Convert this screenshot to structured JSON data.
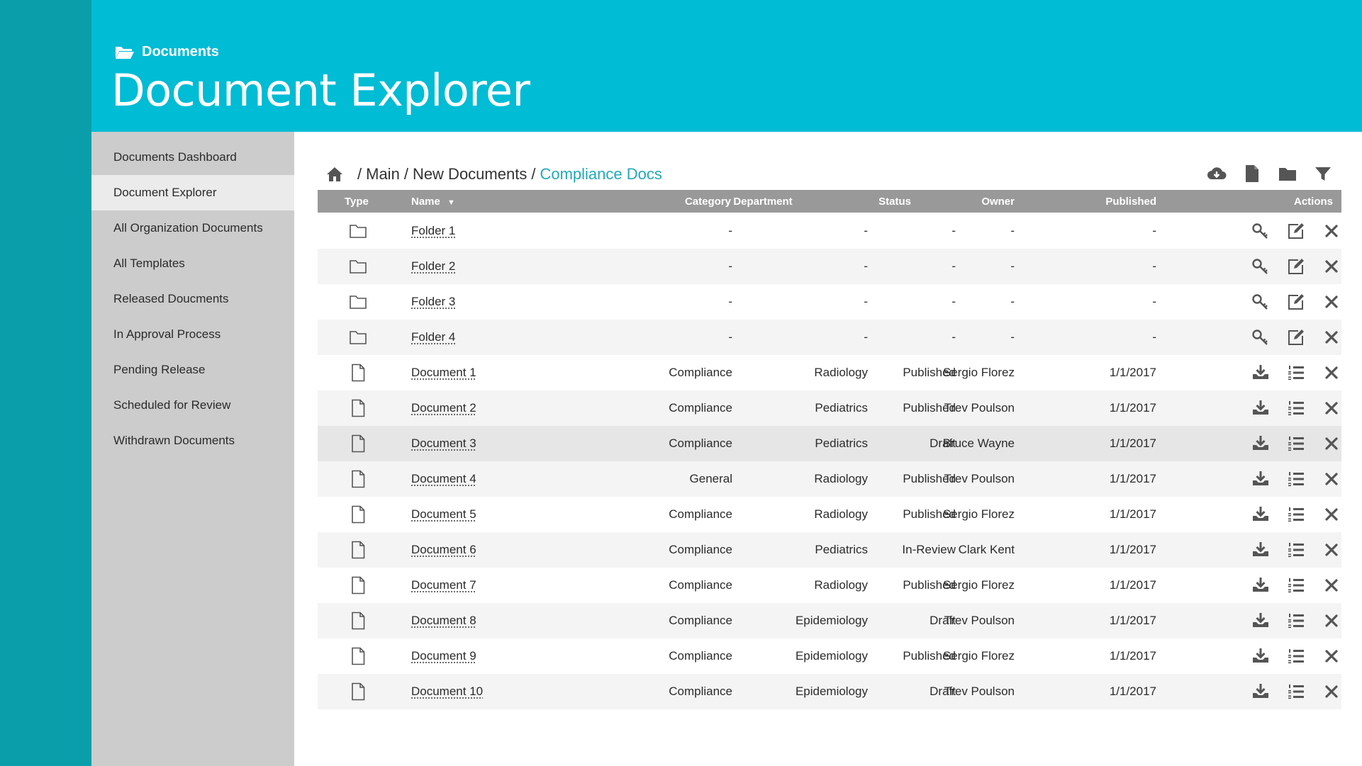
{
  "header": {
    "section": "Documents",
    "title": "Document Explorer"
  },
  "sidebar": {
    "items": [
      {
        "label": "Documents Dashboard"
      },
      {
        "label": "Document Explorer",
        "active": true
      },
      {
        "label": "All Organization Documents"
      },
      {
        "label": "All Templates"
      },
      {
        "label": "Released Doucments"
      },
      {
        "label": "In Approval Process"
      },
      {
        "label": "Pending Release"
      },
      {
        "label": "Scheduled for Review"
      },
      {
        "label": "Withdrawn Documents"
      }
    ]
  },
  "breadcrumb": {
    "home_icon": "home-icon",
    "sep": "/",
    "items": [
      "Main",
      "New Documents"
    ],
    "current": "Compliance Docs"
  },
  "toolbar_icons": [
    "cloud-download-icon",
    "new-document-icon",
    "new-folder-icon",
    "filter-icon"
  ],
  "table": {
    "columns": {
      "type": "Type",
      "name": "Name",
      "category": "Category",
      "department": "Department",
      "status": "Status",
      "owner": "Owner",
      "published": "Published",
      "actions": "Actions"
    },
    "rows": [
      {
        "type": "folder",
        "name": "Folder 1",
        "category": "-",
        "department": "-",
        "status": "-",
        "owner": "-",
        "published": "-"
      },
      {
        "type": "folder",
        "name": "Folder 2",
        "category": "-",
        "department": "-",
        "status": "-",
        "owner": "-",
        "published": "-"
      },
      {
        "type": "folder",
        "name": "Folder 3",
        "category": "-",
        "department": "-",
        "status": "-",
        "owner": "-",
        "published": "-"
      },
      {
        "type": "folder",
        "name": "Folder 4",
        "category": "-",
        "department": "-",
        "status": "-",
        "owner": "-",
        "published": "-"
      },
      {
        "type": "document",
        "name": "Document 1",
        "category": "Compliance",
        "department": "Radiology",
        "status": "Published",
        "owner": "Sergio Florez",
        "published": "1/1/2017"
      },
      {
        "type": "document",
        "name": "Document 2",
        "category": "Compliance",
        "department": "Pediatrics",
        "status": "Published",
        "owner": "Trev Poulson",
        "published": "1/1/2017"
      },
      {
        "type": "document",
        "name": "Document 3",
        "category": "Compliance",
        "department": "Pediatrics",
        "status": "Draft",
        "owner": "Bruce Wayne",
        "published": "1/1/2017",
        "highlight": true
      },
      {
        "type": "document",
        "name": "Document 4",
        "category": "General",
        "department": "Radiology",
        "status": "Published",
        "owner": "Trev Poulson",
        "published": "1/1/2017"
      },
      {
        "type": "document",
        "name": "Document 5",
        "category": "Compliance",
        "department": "Radiology",
        "status": "Published",
        "owner": "Sergio Florez",
        "published": "1/1/2017"
      },
      {
        "type": "document",
        "name": "Document 6",
        "category": "Compliance",
        "department": "Pediatrics",
        "status": "In-Review",
        "owner": "Clark Kent",
        "published": "1/1/2017"
      },
      {
        "type": "document",
        "name": "Document 7",
        "category": "Compliance",
        "department": "Radiology",
        "status": "Published",
        "owner": "Sergio Florez",
        "published": "1/1/2017"
      },
      {
        "type": "document",
        "name": "Document 8",
        "category": "Compliance",
        "department": "Epidemiology",
        "status": "Draft",
        "owner": "Trev Poulson",
        "published": "1/1/2017"
      },
      {
        "type": "document",
        "name": "Document 9",
        "category": "Compliance",
        "department": "Epidemiology",
        "status": "Published",
        "owner": "Sergio Florez",
        "published": "1/1/2017"
      },
      {
        "type": "document",
        "name": "Document 10",
        "category": "Compliance",
        "department": "Epidemiology",
        "status": "Draft",
        "owner": "Trev Poulson",
        "published": "1/1/2017"
      }
    ],
    "folder_actions": [
      "key-icon",
      "edit-icon",
      "delete-icon"
    ],
    "document_actions": [
      "download-icon",
      "list-icon",
      "delete-icon"
    ]
  },
  "colors": {
    "header": "#00bcd4",
    "rail": "#0a9eab",
    "sidebar": "#cccccc",
    "sidebar_active": "#ebebeb",
    "table_header": "#999999",
    "link_current": "#22aab9"
  }
}
